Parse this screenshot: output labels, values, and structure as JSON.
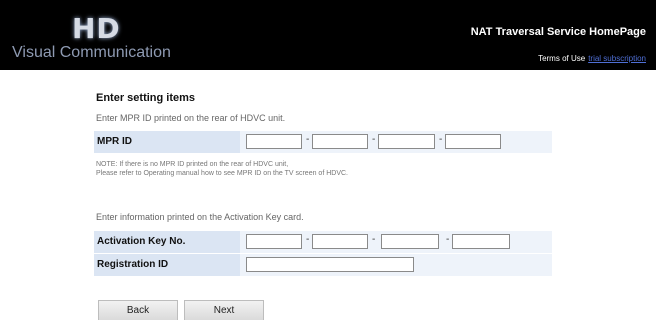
{
  "header": {
    "logo_mark": "HD",
    "logo_text": "Visual Communication",
    "site_title": "NAT Traversal Service HomePage",
    "terms_label": "Terms of Use",
    "trial_link": "trial subscription"
  },
  "form": {
    "section_title": "Enter setting items",
    "mpr_instruction": "Enter MPR ID printed on the rear of HDVC unit.",
    "mpr_label": "MPR ID",
    "mpr_values": [
      "",
      "",
      "",
      ""
    ],
    "mpr_separators": [
      "-",
      "-",
      "-"
    ],
    "note_line1": "NOTE:  If there is no MPR ID printed on the rear of HDVC unit,",
    "note_line2": "Please refer to Operating manual how to see MPR ID on the TV screen of HDVC.",
    "key_instruction": "Enter information printed on the Activation Key card.",
    "activation_label": "Activation Key No.",
    "activation_values": [
      "",
      "",
      "",
      ""
    ],
    "activation_separators": [
      "-",
      "-",
      "-"
    ],
    "registration_label": "Registration ID",
    "registration_value": ""
  },
  "buttons": {
    "back": "Back",
    "next": "Next"
  },
  "colors": {
    "header_bg": "#000000",
    "label_bg": "#dbe5f3",
    "field_bg": "#eef3fa",
    "link": "#4f6fd6"
  }
}
